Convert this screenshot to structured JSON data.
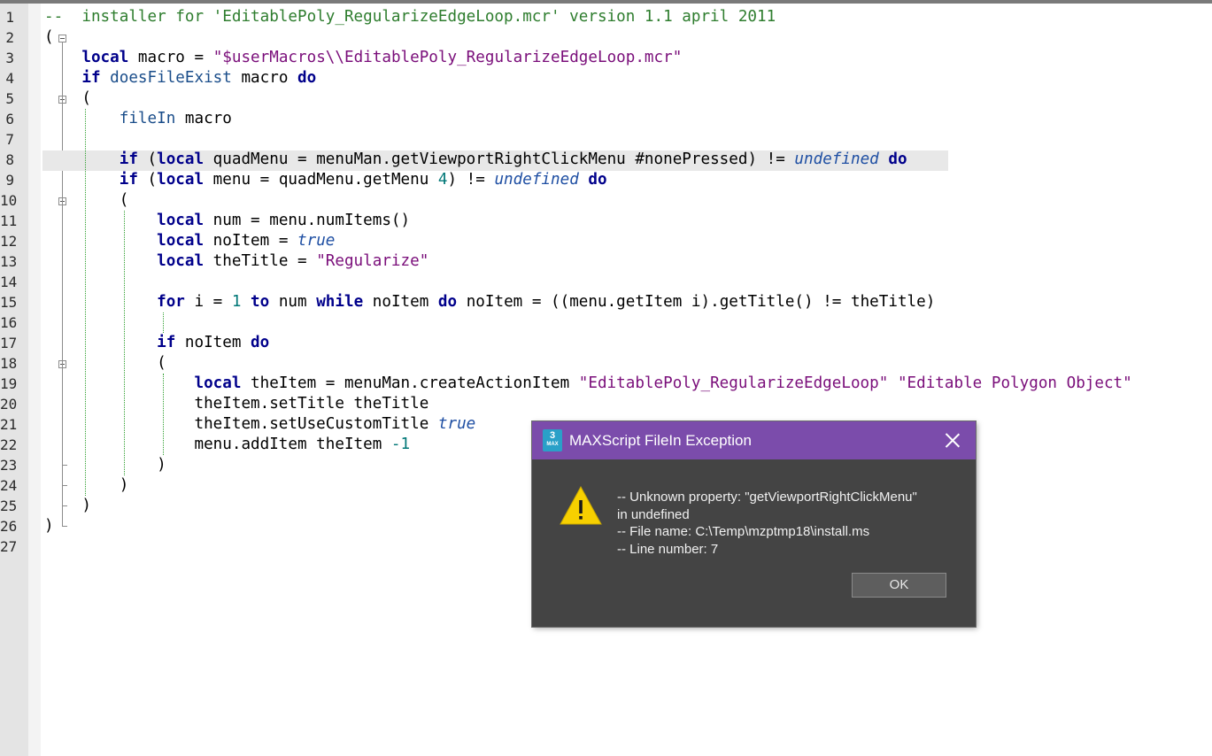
{
  "editor": {
    "line_numbers": [
      "1",
      "2",
      "3",
      "4",
      "5",
      "6",
      "7",
      "8",
      "9",
      "10",
      "11",
      "12",
      "13",
      "14",
      "15",
      "16",
      "17",
      "18",
      "19",
      "20",
      "21",
      "22",
      "23",
      "24",
      "25",
      "26",
      "27"
    ],
    "lines": [
      [
        {
          "t": "--  installer for 'EditablePoly_RegularizeEdgeLoop.mcr' version 1.1 april 2011",
          "c": "cm"
        }
      ],
      [
        {
          "t": "(",
          "c": ""
        }
      ],
      [
        {
          "t": "    ",
          "c": ""
        },
        {
          "t": "local",
          "c": "kw"
        },
        {
          "t": " macro = ",
          "c": ""
        },
        {
          "t": "\"$userMacros\\\\EditablePoly_RegularizeEdgeLoop.mcr\"",
          "c": "str"
        }
      ],
      [
        {
          "t": "    ",
          "c": ""
        },
        {
          "t": "if",
          "c": "kw"
        },
        {
          "t": " ",
          "c": ""
        },
        {
          "t": "doesFileExist",
          "c": "fn"
        },
        {
          "t": " macro ",
          "c": ""
        },
        {
          "t": "do",
          "c": "kw"
        }
      ],
      [
        {
          "t": "    (",
          "c": ""
        }
      ],
      [
        {
          "t": "        ",
          "c": ""
        },
        {
          "t": "fileIn",
          "c": "fn"
        },
        {
          "t": " macro",
          "c": ""
        }
      ],
      [
        {
          "t": "",
          "c": ""
        }
      ],
      [
        {
          "t": "        ",
          "c": ""
        },
        {
          "t": "if",
          "c": "kw"
        },
        {
          "t": " (",
          "c": ""
        },
        {
          "t": "local",
          "c": "kw"
        },
        {
          "t": " quadMenu = menuMan.getViewportRightClickMenu #nonePressed) != ",
          "c": ""
        },
        {
          "t": "undefined",
          "c": "lit"
        },
        {
          "t": " ",
          "c": ""
        },
        {
          "t": "do",
          "c": "kw"
        }
      ],
      [
        {
          "t": "        ",
          "c": ""
        },
        {
          "t": "if",
          "c": "kw"
        },
        {
          "t": " (",
          "c": ""
        },
        {
          "t": "local",
          "c": "kw"
        },
        {
          "t": " menu = quadMenu.getMenu ",
          "c": ""
        },
        {
          "t": "4",
          "c": "num"
        },
        {
          "t": ") != ",
          "c": ""
        },
        {
          "t": "undefined",
          "c": "lit"
        },
        {
          "t": " ",
          "c": ""
        },
        {
          "t": "do",
          "c": "kw"
        }
      ],
      [
        {
          "t": "        (",
          "c": ""
        }
      ],
      [
        {
          "t": "            ",
          "c": ""
        },
        {
          "t": "local",
          "c": "kw"
        },
        {
          "t": " num = menu.numItems()",
          "c": ""
        }
      ],
      [
        {
          "t": "            ",
          "c": ""
        },
        {
          "t": "local",
          "c": "kw"
        },
        {
          "t": " noItem = ",
          "c": ""
        },
        {
          "t": "true",
          "c": "lit"
        }
      ],
      [
        {
          "t": "            ",
          "c": ""
        },
        {
          "t": "local",
          "c": "kw"
        },
        {
          "t": " theTitle = ",
          "c": ""
        },
        {
          "t": "\"Regularize\"",
          "c": "str"
        }
      ],
      [
        {
          "t": "",
          "c": ""
        }
      ],
      [
        {
          "t": "            ",
          "c": ""
        },
        {
          "t": "for",
          "c": "kw"
        },
        {
          "t": " i = ",
          "c": ""
        },
        {
          "t": "1",
          "c": "num"
        },
        {
          "t": " ",
          "c": ""
        },
        {
          "t": "to",
          "c": "kw"
        },
        {
          "t": " num ",
          "c": ""
        },
        {
          "t": "while",
          "c": "kw"
        },
        {
          "t": " noItem ",
          "c": ""
        },
        {
          "t": "do",
          "c": "kw"
        },
        {
          "t": " noItem = ((menu.getItem i).getTitle() != theTitle)",
          "c": ""
        }
      ],
      [
        {
          "t": "",
          "c": ""
        }
      ],
      [
        {
          "t": "            ",
          "c": ""
        },
        {
          "t": "if",
          "c": "kw"
        },
        {
          "t": " noItem ",
          "c": ""
        },
        {
          "t": "do",
          "c": "kw"
        }
      ],
      [
        {
          "t": "            (",
          "c": ""
        }
      ],
      [
        {
          "t": "                ",
          "c": ""
        },
        {
          "t": "local",
          "c": "kw"
        },
        {
          "t": " theItem = menuMan.createActionItem ",
          "c": ""
        },
        {
          "t": "\"EditablePoly_RegularizeEdgeLoop\"",
          "c": "str"
        },
        {
          "t": " ",
          "c": ""
        },
        {
          "t": "\"Editable Polygon Object\"",
          "c": "str"
        }
      ],
      [
        {
          "t": "                theItem.setTitle theTitle",
          "c": ""
        }
      ],
      [
        {
          "t": "                theItem.setUseCustomTitle ",
          "c": ""
        },
        {
          "t": "true",
          "c": "lit"
        }
      ],
      [
        {
          "t": "                menu.addItem theItem ",
          "c": ""
        },
        {
          "t": "-1",
          "c": "num"
        }
      ],
      [
        {
          "t": "            )",
          "c": ""
        }
      ],
      [
        {
          "t": "        )",
          "c": ""
        }
      ],
      [
        {
          "t": "    )",
          "c": ""
        }
      ],
      [
        {
          "t": ")",
          "c": ""
        }
      ],
      [
        {
          "t": "",
          "c": ""
        }
      ]
    ]
  },
  "dialog": {
    "title": "MAXScript FileIn Exception",
    "app_icon_number": "3",
    "app_icon_text": "MAX",
    "message_lines": [
      "-- Unknown property: \"getViewportRightClickMenu\"",
      "in undefined",
      "-- File name: C:\\Temp\\mzptmp18\\install.ms",
      "-- Line number: 7"
    ],
    "ok_label": "OK"
  }
}
